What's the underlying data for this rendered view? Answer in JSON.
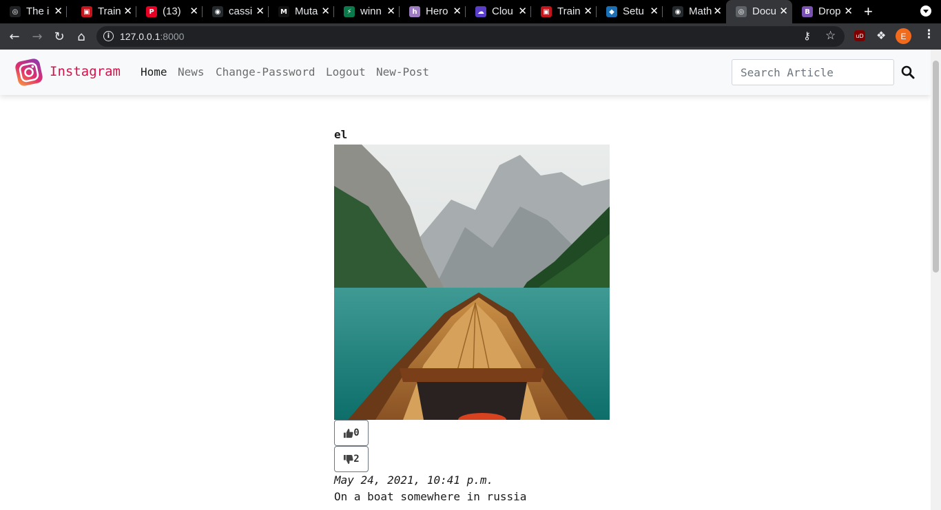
{
  "browser": {
    "tabs": [
      {
        "title": "The i",
        "favicon": "globe-icon",
        "color": "#202124"
      },
      {
        "title": "Train",
        "favicon": "square-icon",
        "color": "#c4141c"
      },
      {
        "title": "(13)",
        "favicon": "pinterest-icon",
        "color": "#e60023"
      },
      {
        "title": "cassi",
        "favicon": "github-icon",
        "color": "#24292e"
      },
      {
        "title": "Muta",
        "favicon": "block-icon",
        "color": "#111111"
      },
      {
        "title": "winn",
        "favicon": "bolt-icon",
        "color": "#0b7a4b"
      },
      {
        "title": "Hero",
        "favicon": "heroku-icon",
        "color": "#9e7cc1"
      },
      {
        "title": "Clou",
        "favicon": "cloud-icon",
        "color": "#5a3ec8"
      },
      {
        "title": "Train",
        "favicon": "square-icon",
        "color": "#c4141c"
      },
      {
        "title": "Setu",
        "favicon": "fox-icon",
        "color": "#1b6fb5"
      },
      {
        "title": "Math",
        "favicon": "github-icon",
        "color": "#24292e"
      },
      {
        "title": "Docu",
        "favicon": "globe-icon",
        "color": "#5f6368"
      },
      {
        "title": "Drop",
        "favicon": "bootstrap-icon",
        "color": "#7952b3"
      }
    ],
    "active_tab": 11,
    "url_host": "127.0.0.1",
    "url_port": ":8000",
    "profile_initial": "E"
  },
  "navbar": {
    "brand": "Instagram",
    "links": [
      "Home",
      "News",
      "Change-Password",
      "Logout",
      "New-Post"
    ],
    "search_placeholder": "Search Article"
  },
  "post": {
    "author": "el",
    "likes": "0",
    "dislikes": "2",
    "date": "May 24, 2021, 10:41 p.m.",
    "caption": "On a boat somewhere in russia"
  }
}
